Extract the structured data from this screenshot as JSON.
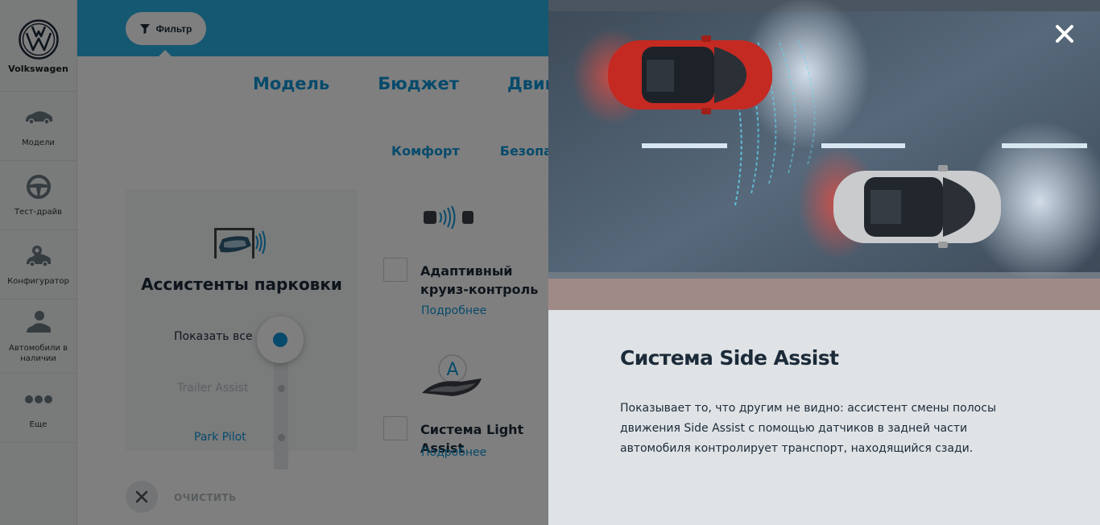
{
  "sidebar": {
    "brand": "Volkswagen",
    "items": [
      {
        "label": "Модели",
        "icon": "car-icon"
      },
      {
        "label": "Тест-драйв",
        "icon": "steering-wheel-icon"
      },
      {
        "label": "Конфигуратор",
        "icon": "configurator-icon"
      },
      {
        "label": "Автомобили в наличии",
        "icon": "car-stock-icon"
      },
      {
        "label": "Еще",
        "icon": "more-dots-icon"
      }
    ]
  },
  "topbar": {
    "filter_label": "Фильтр",
    "accent_color": "#2bb0e3"
  },
  "main_tabs": [
    "Модель",
    "Бюджет",
    "Двигатель"
  ],
  "sub_tabs": [
    "Комфорт",
    "Безопасность"
  ],
  "parking": {
    "title": "Ассистенты парковки",
    "show_all": "Показать все",
    "options": [
      "Trailer Assist",
      "Park Pilot"
    ]
  },
  "features": [
    {
      "title": "Адаптивный круиз-контроль",
      "link": "Подробнее"
    },
    {
      "title": "Система Light Assist",
      "link": "Подробнее"
    }
  ],
  "clear_label": "ОЧИСТИТЬ",
  "modal": {
    "title": "Система Side Assist",
    "text": "Показывает то, что другим не видно: ассистент смены полосы движения Side Assist с помощью датчиков в задней части автомобиля контролирует транспорт, находящийся сзади.",
    "close_icon": "close-icon"
  }
}
